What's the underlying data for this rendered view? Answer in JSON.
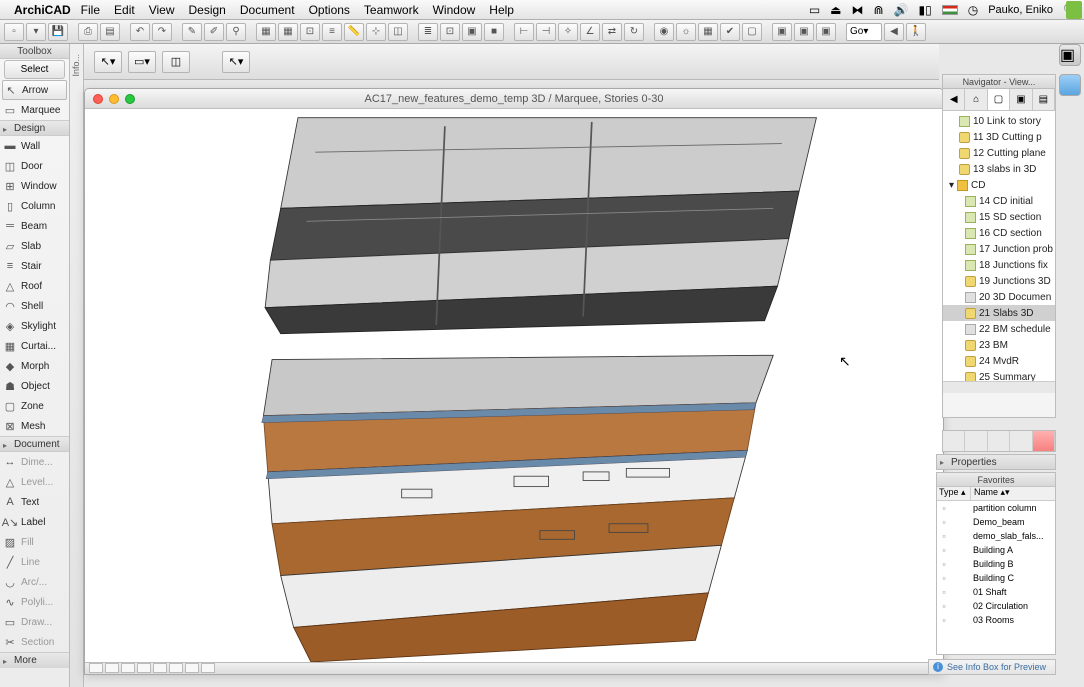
{
  "menubar": {
    "app": "ArchiCAD",
    "items": [
      "File",
      "Edit",
      "View",
      "Design",
      "Document",
      "Options",
      "Teamwork",
      "Window",
      "Help"
    ],
    "user": "Pauko, Eniko"
  },
  "toolbox": {
    "title": "Toolbox",
    "select_btn": "Select",
    "groups": {
      "design": "Design",
      "document": "Document",
      "more": "More"
    },
    "select_items": [
      {
        "label": "Arrow",
        "icon": "↖"
      },
      {
        "label": "Marquee",
        "icon": "▭"
      }
    ],
    "design_items": [
      {
        "label": "Wall",
        "icon": "▬"
      },
      {
        "label": "Door",
        "icon": "◫"
      },
      {
        "label": "Window",
        "icon": "⊞"
      },
      {
        "label": "Column",
        "icon": "▯"
      },
      {
        "label": "Beam",
        "icon": "═"
      },
      {
        "label": "Slab",
        "icon": "▱"
      },
      {
        "label": "Stair",
        "icon": "≡"
      },
      {
        "label": "Roof",
        "icon": "△"
      },
      {
        "label": "Shell",
        "icon": "◠"
      },
      {
        "label": "Skylight",
        "icon": "◈"
      },
      {
        "label": "Curtai...",
        "icon": "▦"
      },
      {
        "label": "Morph",
        "icon": "◆"
      },
      {
        "label": "Object",
        "icon": "☗"
      },
      {
        "label": "Zone",
        "icon": "▢"
      },
      {
        "label": "Mesh",
        "icon": "⊠"
      }
    ],
    "document_items": [
      {
        "label": "Dime...",
        "icon": "↔",
        "dim": true
      },
      {
        "label": "Level...",
        "icon": "△",
        "dim": true
      },
      {
        "label": "Text",
        "icon": "A"
      },
      {
        "label": "Label",
        "icon": "A↘"
      },
      {
        "label": "Fill",
        "icon": "▨",
        "dim": true
      },
      {
        "label": "Line",
        "icon": "╱",
        "dim": true
      },
      {
        "label": "Arc/...",
        "icon": "◡",
        "dim": true
      },
      {
        "label": "Polyli...",
        "icon": "∿",
        "dim": true
      },
      {
        "label": "Draw...",
        "icon": "▭",
        "dim": true
      },
      {
        "label": "Section",
        "icon": "✂",
        "dim": true
      }
    ]
  },
  "info_strip": "Info...",
  "window": {
    "title": "AC17_new_features_demo_temp 3D / Marquee, Stories 0-30"
  },
  "navigator": {
    "title": "Navigator - View...",
    "items": [
      {
        "label": "10 Link to story",
        "icon": "view",
        "lvl": 1
      },
      {
        "label": "11 3D Cutting p",
        "icon": "cam",
        "lvl": 1
      },
      {
        "label": "12 Cutting plane",
        "icon": "cam",
        "lvl": 1
      },
      {
        "label": "13 slabs in 3D",
        "icon": "cam",
        "lvl": 1
      },
      {
        "label": "CD",
        "icon": "folder",
        "lvl": 0,
        "expand": true
      },
      {
        "label": "14 CD initial",
        "icon": "view",
        "lvl": 2
      },
      {
        "label": "15 SD section",
        "icon": "view",
        "lvl": 2
      },
      {
        "label": "16 CD section",
        "icon": "view",
        "lvl": 2
      },
      {
        "label": "17 Junction prob",
        "icon": "view",
        "lvl": 2
      },
      {
        "label": "18 Junctions fix",
        "icon": "view",
        "lvl": 2
      },
      {
        "label": "19 Junctions 3D",
        "icon": "cam",
        "lvl": 2
      },
      {
        "label": "20 3D Documen",
        "icon": "doc",
        "lvl": 2
      },
      {
        "label": "21 Slabs 3D",
        "icon": "cam",
        "lvl": 2,
        "sel": true
      },
      {
        "label": "22 BM schedule",
        "icon": "doc",
        "lvl": 2
      },
      {
        "label": "23 BM",
        "icon": "cam",
        "lvl": 2
      },
      {
        "label": "24 MvdR",
        "icon": "cam",
        "lvl": 2
      },
      {
        "label": "25 Summary",
        "icon": "cam",
        "lvl": 2
      }
    ]
  },
  "properties_title": "Properties",
  "favorites": {
    "title": "Favorites",
    "col_type": "Type",
    "col_name": "Name",
    "items": [
      {
        "name": "partition column"
      },
      {
        "name": "Demo_beam"
      },
      {
        "name": "demo_slab_fals..."
      },
      {
        "name": "Building A"
      },
      {
        "name": "Building B"
      },
      {
        "name": "Building C"
      },
      {
        "name": "01 Shaft"
      },
      {
        "name": "02 Circulation"
      },
      {
        "name": "03 Rooms"
      }
    ]
  },
  "bottom_info": "See Info Box for Preview",
  "go_label": "Go"
}
